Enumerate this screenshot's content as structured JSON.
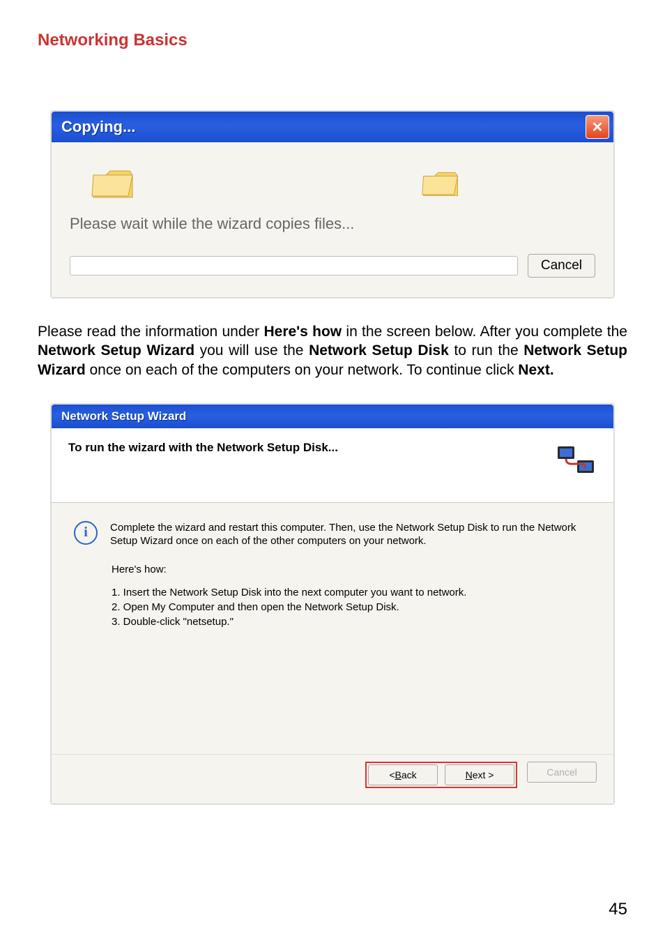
{
  "page": {
    "title": "Networking Basics",
    "number": "45"
  },
  "copy_dialog": {
    "title": "Copying...",
    "close_symbol": "✕",
    "message": "Please wait while the wizard copies files...",
    "cancel": "Cancel"
  },
  "paragraph": {
    "p1a": "Please read the information under ",
    "p1b": "Here's how",
    "p1c": " in the screen below.  After you complete the ",
    "p1d": "Network Setup Wizard",
    "p1e": " you will use the ",
    "p1f": "Network Setup Disk",
    "p1g": " to run the ",
    "p1h": "Network Setup Wizard",
    "p1i": " once on each of the computers on your network. To continue click ",
    "p1j": "Next."
  },
  "wizard": {
    "title": "Network Setup Wizard",
    "header": "To run the wizard with the Network Setup Disk...",
    "info_char": "i",
    "info": "Complete the wizard and restart this computer. Then, use the Network Setup Disk to run the Network Setup Wizard once on each of the other computers on your network.",
    "heres_how": "Here's how:",
    "step1": "1.  Insert the Network Setup Disk into the next computer you want to network.",
    "step2": "2.  Open My Computer and then open the Network Setup Disk.",
    "step3": "3.  Double-click \"netsetup.\"",
    "back_pre": "< ",
    "back_key": "B",
    "back_post": "ack",
    "next_key": "N",
    "next_post": "ext >",
    "cancel": "Cancel"
  },
  "chart_data": null
}
